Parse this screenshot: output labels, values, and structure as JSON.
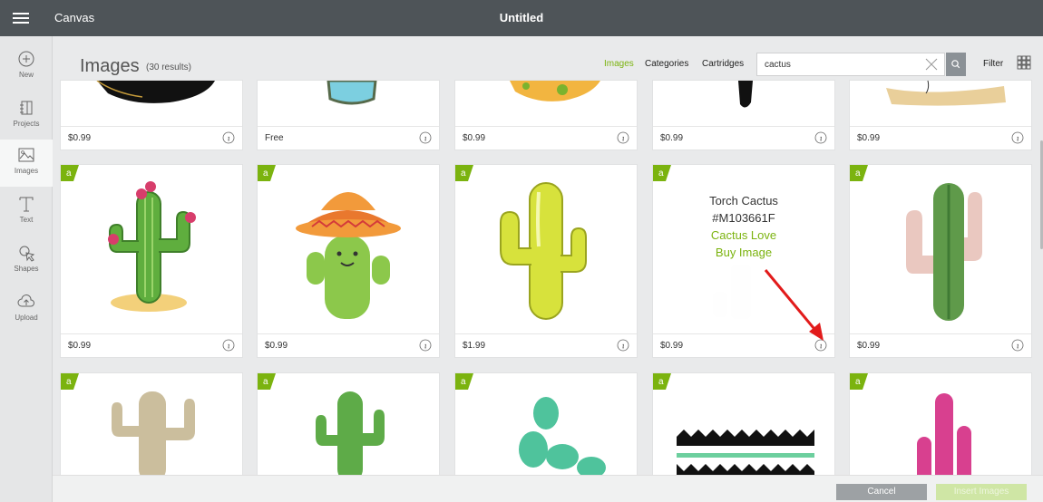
{
  "header": {
    "app_name": "Canvas",
    "doc_title": "Untitled"
  },
  "sidebar": {
    "items": [
      {
        "label": "New",
        "icon": "plus-circle-icon"
      },
      {
        "label": "Projects",
        "icon": "projects-icon"
      },
      {
        "label": "Images",
        "icon": "image-icon",
        "active": true
      },
      {
        "label": "Text",
        "icon": "text-icon"
      },
      {
        "label": "Shapes",
        "icon": "shapes-icon"
      },
      {
        "label": "Upload",
        "icon": "upload-cloud-icon"
      }
    ]
  },
  "library": {
    "title": "Images",
    "results_count": "(30 results)",
    "tabs": {
      "images": "Images",
      "categories": "Categories",
      "cartridges": "Cartridges"
    },
    "active_tab": "Images",
    "search": {
      "value": "cactus",
      "placeholder": ""
    },
    "filter_label": "Filter"
  },
  "grid": {
    "row1": [
      {
        "price": "$0.99"
      },
      {
        "price": "Free"
      },
      {
        "price": "$0.99"
      },
      {
        "price": "$0.99"
      },
      {
        "price": "$0.99"
      }
    ],
    "row2": [
      {
        "price": "$0.99",
        "badge": "a"
      },
      {
        "price": "$0.99",
        "badge": "a"
      },
      {
        "price": "$1.99",
        "badge": "a"
      },
      {
        "price": "$0.99",
        "badge": "a"
      },
      {
        "price": "$0.99",
        "badge": "a"
      }
    ],
    "row3": [
      {
        "badge": "a"
      },
      {
        "badge": "a"
      },
      {
        "badge": "a"
      },
      {
        "badge": "a"
      },
      {
        "badge": "a"
      }
    ]
  },
  "hover_card": {
    "name": "Torch Cactus",
    "code": "#M103661F",
    "cartridge": "Cactus Love",
    "buy_label": "Buy Image"
  },
  "footer": {
    "cancel_label": "Cancel",
    "insert_label": "Insert Images"
  },
  "colors": {
    "topbar": "#4e5458",
    "accent": "#7bb30f",
    "badge": "#7bb30f",
    "annotation_arrow": "#e21b1b"
  }
}
